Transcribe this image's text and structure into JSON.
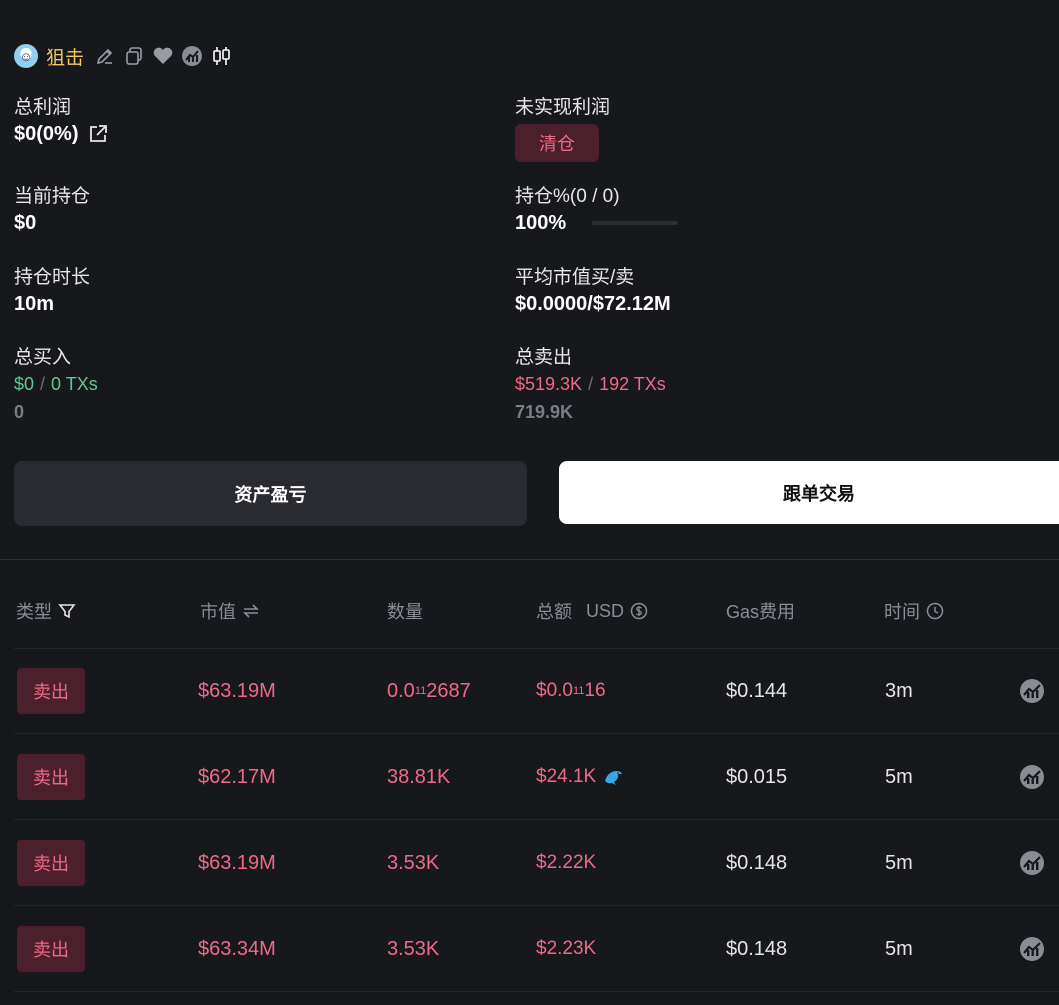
{
  "header": {
    "name": "狙击"
  },
  "stats": {
    "total_profit": {
      "label": "总利润",
      "value": "$0(0%)"
    },
    "unrealized": {
      "label": "未实现利润",
      "clear_label": "清仓"
    },
    "position": {
      "label": "当前持仓",
      "value": "$0"
    },
    "position_pct": {
      "label": "持仓%(0 / 0)",
      "value": "100%",
      "fill_fraction": 0
    },
    "hold_time": {
      "label": "持仓时长",
      "value": "10m"
    },
    "avg_mcap": {
      "label": "平均市值买/卖",
      "value": "$0.0000/$72.12M"
    },
    "total_buy": {
      "label": "总买入",
      "amount": "$0",
      "sep": "/",
      "txs": "0 TXs",
      "sub": "0"
    },
    "total_sell": {
      "label": "总卖出",
      "amount": "$519.3K",
      "sep": "/",
      "txs": "192 TXs",
      "sub": "719.9K"
    }
  },
  "tabs": {
    "pnl": "资产盈亏",
    "copy": "跟单交易"
  },
  "table": {
    "headers": {
      "type": "类型",
      "mcap": "市值",
      "qty": "数量",
      "total": "总额",
      "total_unit": "USD",
      "gas": "Gas费用",
      "time": "时间"
    },
    "rows": [
      {
        "type": "卖出",
        "mcap": "$63.19M",
        "qty_a": "0.0",
        "qty_sub": "11",
        "qty_b": "2687",
        "total_a": "$0.0",
        "total_sub": "11",
        "total_b": "16",
        "gas": "$0.144",
        "time": "3m",
        "whale": false
      },
      {
        "type": "卖出",
        "mcap": "$62.17M",
        "qty_a": "38.81K",
        "qty_sub": "",
        "qty_b": "",
        "total_a": "$24.1K",
        "total_sub": "",
        "total_b": "",
        "gas": "$0.015",
        "time": "5m",
        "whale": true
      },
      {
        "type": "卖出",
        "mcap": "$63.19M",
        "qty_a": "3.53K",
        "qty_sub": "",
        "qty_b": "",
        "total_a": "$2.22K",
        "total_sub": "",
        "total_b": "",
        "gas": "$0.148",
        "time": "5m",
        "whale": false
      },
      {
        "type": "卖出",
        "mcap": "$63.34M",
        "qty_a": "3.53K",
        "qty_sub": "",
        "qty_b": "",
        "total_a": "$2.23K",
        "total_sub": "",
        "total_b": "",
        "gas": "$0.148",
        "time": "5m",
        "whale": false
      }
    ]
  },
  "colors": {
    "background": "#17181c",
    "sell": "#ee6a88",
    "buy": "#5fc98c",
    "name": "#f3c766"
  }
}
